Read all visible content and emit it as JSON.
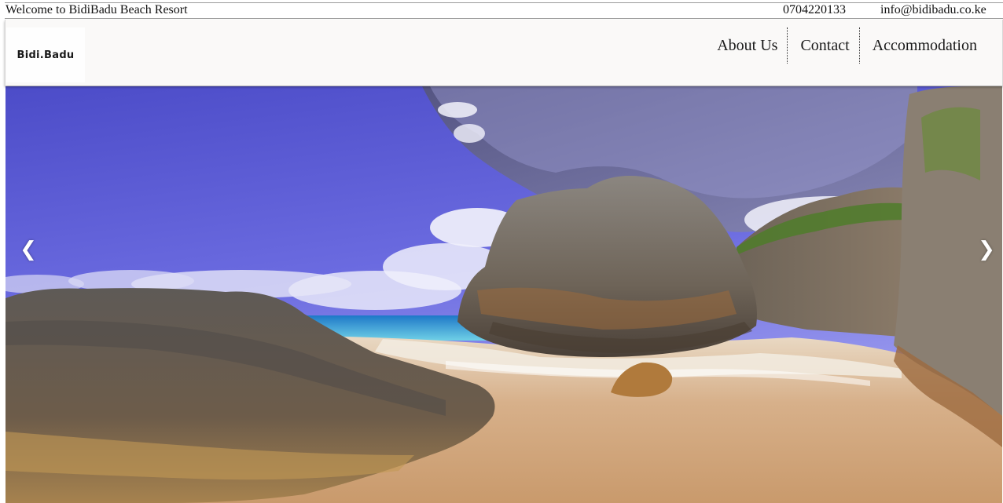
{
  "topbar": {
    "welcome": "Welcome to BidiBadu Beach Resort",
    "phone": "0704220133",
    "email": "info@bidibadu.co.ke"
  },
  "header": {
    "logo_text": "Bidi.Badu",
    "nav": [
      {
        "label": "About Us"
      },
      {
        "label": "Contact"
      },
      {
        "label": "Accommodation"
      }
    ]
  },
  "slideshow": {
    "prev_label": "❮",
    "next_label": "❯",
    "prev_icon": "chevron-left-icon",
    "next_icon": "chevron-right-icon"
  },
  "colors": {
    "sky_top": "#5b5bd8",
    "sky_light": "#8f8ff0",
    "sea": "#3aa9d6",
    "sand": "#d9b48c",
    "rock": "#7a6a58",
    "header_bg": "#faf9f8"
  }
}
